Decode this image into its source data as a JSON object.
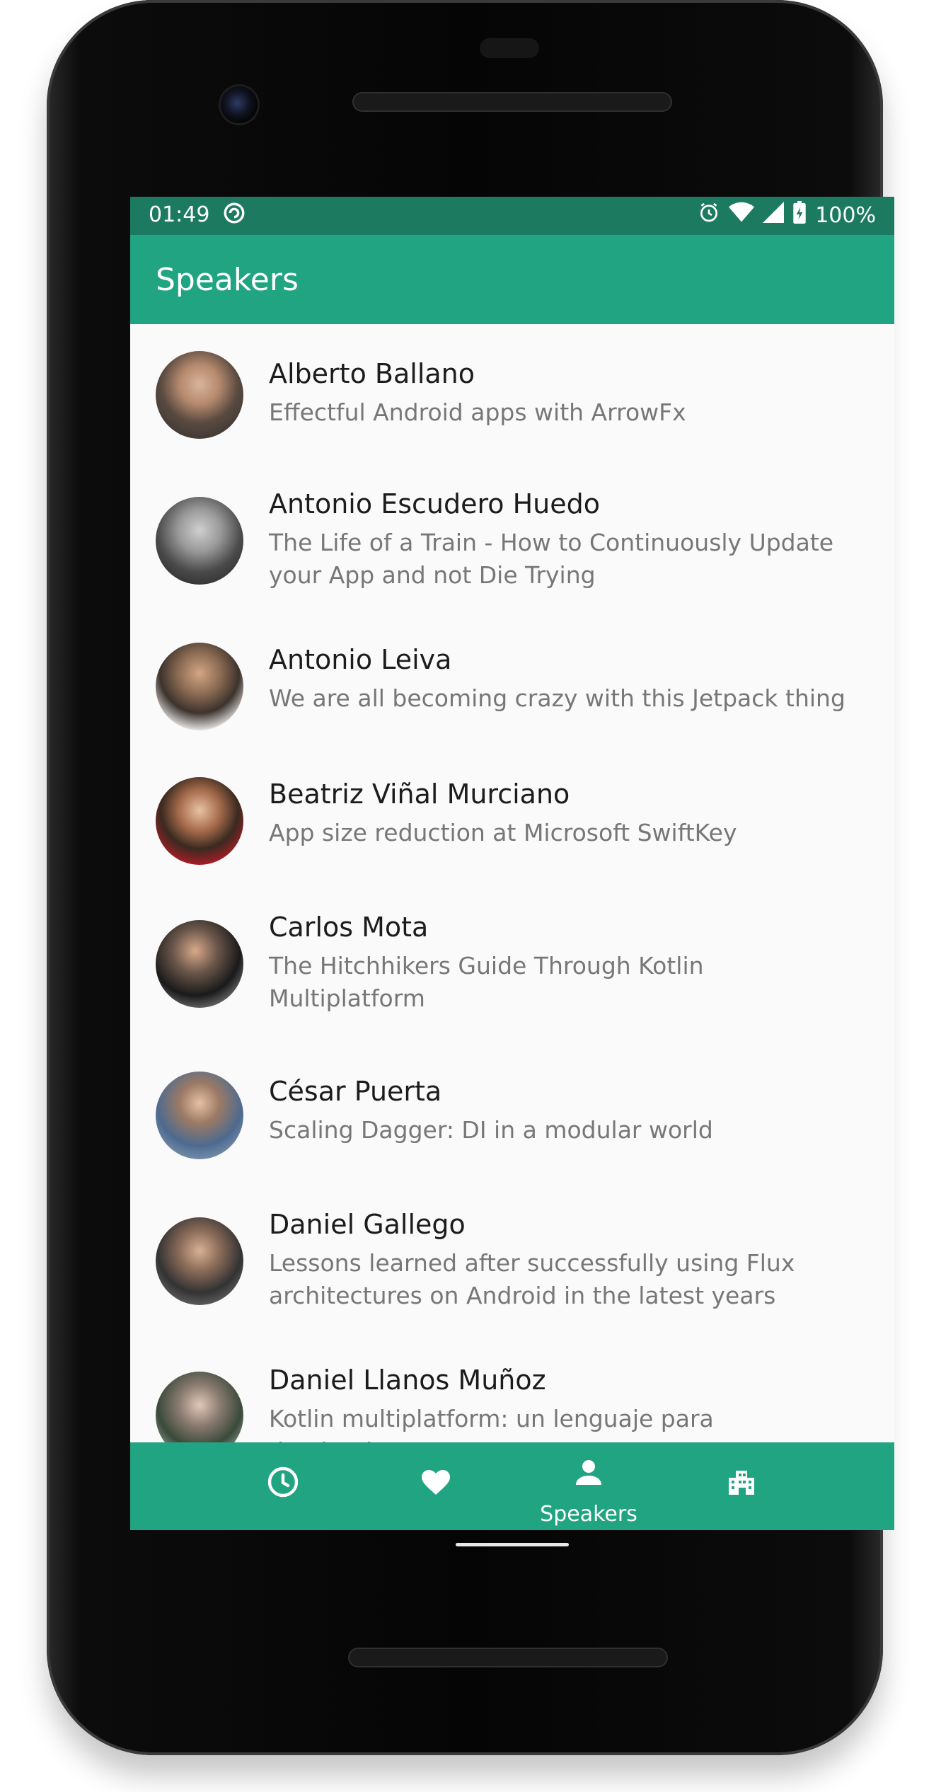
{
  "status_bar": {
    "time": "01:49",
    "sync_icon": "sync-circle-icon",
    "alarm_icon": "alarm-icon",
    "wifi_icon": "wifi-icon",
    "signal_icon": "signal-icon",
    "battery_icon": "battery-charging-icon",
    "battery": "100%"
  },
  "app_bar": {
    "title": "Speakers"
  },
  "speakers": [
    {
      "name": "Alberto Ballano",
      "talk": "Effectful Android apps with ArrowFx"
    },
    {
      "name": "Antonio Escudero Huedo",
      "talk": "The Life of a Train - How to Continuously Update your App and not Die Trying"
    },
    {
      "name": "Antonio Leiva",
      "talk": "We are all becoming crazy with this Jetpack thing"
    },
    {
      "name": "Beatriz Viñal Murciano",
      "talk": "App size reduction at Microsoft SwiftKey"
    },
    {
      "name": "Carlos Mota",
      "talk": "The Hitchhikers Guide Through Kotlin Multiplatform"
    },
    {
      "name": "César Puerta",
      "talk": "Scaling Dagger: DI in a modular world"
    },
    {
      "name": "Daniel Gallego",
      "talk": "Lessons learned after successfully using Flux architectures on Android in the latest years"
    },
    {
      "name": "Daniel Llanos Muñoz",
      "talk": "Kotlin multiplatform: un lenguaje para dominarlos"
    }
  ],
  "bottom_nav": {
    "items": [
      {
        "icon": "clock-icon",
        "label": ""
      },
      {
        "icon": "heart-icon",
        "label": ""
      },
      {
        "icon": "person-icon",
        "label": "Speakers"
      },
      {
        "icon": "building-icon",
        "label": ""
      }
    ],
    "active": "Speakers"
  },
  "colors": {
    "primary": "#20a482",
    "status_bar": "#1b7a5f",
    "background": "#fafafa",
    "name_text": "#1c1c1c",
    "talk_text": "#777777"
  }
}
